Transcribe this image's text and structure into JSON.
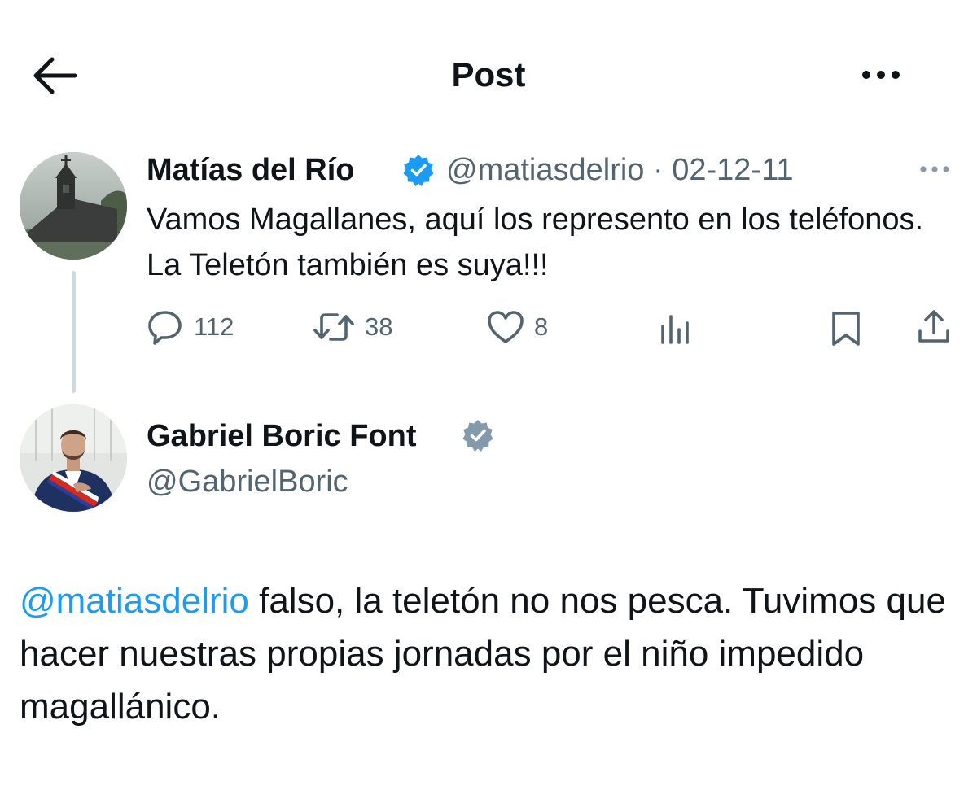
{
  "header": {
    "title": "Post"
  },
  "parent_post": {
    "author_name": "Matías del  Río",
    "handle": "@matiasdelrio",
    "separator": "·",
    "date": "02-12-11",
    "text": "Vamos Magallanes, aquí los represento en los teléfonos. La Teletón también es suya!!!",
    "verified_badge_color": "#1d9bf0",
    "actions": {
      "replies": "112",
      "reposts": "38",
      "likes": "8"
    }
  },
  "main_post": {
    "author_name": "Gabriel Boric Font",
    "handle": "@GabrielBoric",
    "verified_badge_color": "#829aab",
    "mention": "@matiasdelrio",
    "text": " falso, la teletón no nos pesca. Tuvimos que hacer nuestras propias jornadas por el niño impedido magallánico."
  },
  "colors": {
    "link": "#1d9bf0",
    "secondary_text": "#536471",
    "thread_line": "#cfd9de"
  },
  "icons": [
    "back-arrow-icon",
    "more-icon",
    "verified-icon",
    "reply-icon",
    "repost-icon",
    "like-icon",
    "views-icon",
    "bookmark-icon",
    "share-icon"
  ]
}
